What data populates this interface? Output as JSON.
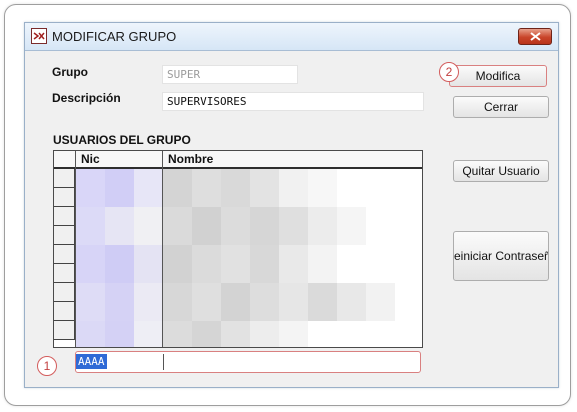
{
  "window": {
    "title": "MODIFICAR GRUPO",
    "app_icon": "app-logo-icon",
    "close_icon": "close-icon"
  },
  "form": {
    "grupo_label": "Grupo",
    "grupo_value": "SUPER",
    "descripcion_label": "Descripción",
    "descripcion_value": "SUPERVISORES"
  },
  "users_section": {
    "title": "USUARIOS DEL GRUPO",
    "columns": [
      "Nic",
      "Nombre"
    ],
    "edit_row_nic": "AAAA"
  },
  "buttons": {
    "modifica": "Modifica",
    "cerrar": "Cerrar",
    "quitar_usuario": "Quitar Usuario",
    "reiniciar": "einiciar Contraseñ"
  },
  "markers": {
    "one": "1",
    "two": "2"
  },
  "colors": {
    "selection": "#2f6ad6",
    "highlight_border": "#d98080",
    "close_button": "#c9452a"
  }
}
